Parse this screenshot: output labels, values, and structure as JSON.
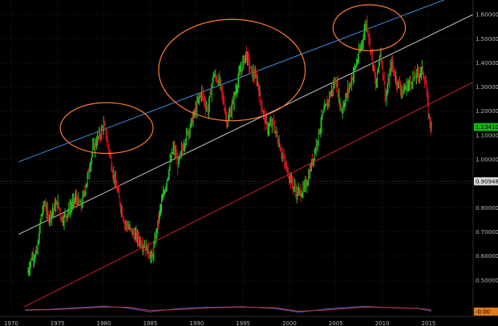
{
  "chart_data": {
    "type": "ohlc",
    "xlim": [
      1968.8,
      2019.8
    ],
    "ylim": [
      0.4,
      1.66
    ],
    "x_ticks": [
      "1970",
      "1975",
      "1980",
      "1985",
      "1990",
      "1995",
      "2000",
      "2005",
      "2010",
      "2015"
    ],
    "y_ticks": [
      "0.50000",
      "0.60000",
      "0.70000",
      "0.80000",
      "0.90000",
      "1.00000",
      "1.10000",
      "1.20000",
      "1.30000",
      "1.40000",
      "1.50000",
      "1.60000"
    ],
    "grid": "dotted",
    "colors": {
      "background": "#000000",
      "up": "#22c51e",
      "down": "#d2141e",
      "upper_channel": "#3f8fe0",
      "mid_channel": "#c8c8c8",
      "lower_channel": "#cc2020",
      "highlight_ellipse": "#ff7a3a",
      "last_price_flag": "#12b812",
      "crosshair_flag": "#d8d8d8"
    },
    "last_price": {
      "label": "1.13410",
      "value": 1.1341
    },
    "crosshair": {
      "label": "0.90948",
      "value": 0.90948
    },
    "trend_lines": [
      {
        "name": "upper-channel",
        "points": [
          [
            1970.8,
            0.99
          ],
          [
            2018.0,
            1.68
          ]
        ]
      },
      {
        "name": "mid-channel",
        "points": [
          [
            1970.8,
            0.69
          ],
          [
            2019.8,
            1.6
          ]
        ]
      },
      {
        "name": "lower-channel",
        "points": [
          [
            1971.4,
            0.39
          ],
          [
            2019.8,
            1.32
          ]
        ]
      }
    ],
    "highlight_ellipses": [
      {
        "name": "peak-1980",
        "center": [
          1980.3,
          1.13
        ],
        "radius": [
          5.0,
          0.105
        ]
      },
      {
        "name": "peak-1995",
        "center": [
          1993.8,
          1.37
        ],
        "radius": [
          7.9,
          0.21
        ]
      },
      {
        "name": "peak-2008",
        "center": [
          2008.6,
          1.545
        ],
        "radius": [
          3.9,
          0.095
        ]
      }
    ],
    "indicator_panel": {
      "label": "-0.00",
      "series_colors": [
        "#3f5fd0",
        "#c03030"
      ],
      "values": [
        [
          1971.5,
          0.05,
          -0.04
        ],
        [
          1974.0,
          0.15,
          0.05
        ],
        [
          1977.0,
          0.55,
          0.35
        ],
        [
          1980.0,
          0.95,
          0.75
        ],
        [
          1982.5,
          0.5,
          0.7
        ],
        [
          1985.0,
          -0.45,
          -0.1
        ],
        [
          1988.0,
          0.35,
          0.1
        ],
        [
          1991.0,
          0.65,
          0.5
        ],
        [
          1995.0,
          0.8,
          0.7
        ],
        [
          1998.5,
          0.35,
          0.55
        ],
        [
          2001.0,
          -0.55,
          -0.3
        ],
        [
          2004.0,
          0.25,
          0.0
        ],
        [
          2008.0,
          0.9,
          0.7
        ],
        [
          2011.0,
          0.55,
          0.6
        ],
        [
          2014.0,
          0.35,
          0.4
        ],
        [
          2015.3,
          -0.3,
          0.05
        ]
      ]
    },
    "series": [
      {
        "name": "",
        "path": [
          [
            1971.8,
            0.535
          ],
          [
            1972.2,
            0.595
          ],
          [
            1972.8,
            0.615
          ],
          [
            1973.2,
            0.76
          ],
          [
            1973.6,
            0.82
          ],
          [
            1974.0,
            0.76
          ],
          [
            1974.5,
            0.79
          ],
          [
            1975.0,
            0.82
          ],
          [
            1975.5,
            0.75
          ],
          [
            1976.2,
            0.79
          ],
          [
            1977.0,
            0.84
          ],
          [
            1977.5,
            0.8
          ],
          [
            1978.2,
            0.92
          ],
          [
            1978.8,
            1.04
          ],
          [
            1979.5,
            1.1
          ],
          [
            1980.0,
            1.14
          ],
          [
            1980.5,
            1.05
          ],
          [
            1981.0,
            0.94
          ],
          [
            1981.5,
            0.86
          ],
          [
            1982.2,
            0.74
          ],
          [
            1983.0,
            0.7
          ],
          [
            1984.0,
            0.66
          ],
          [
            1984.8,
            0.62
          ],
          [
            1985.2,
            0.59
          ],
          [
            1986.0,
            0.78
          ],
          [
            1986.8,
            0.92
          ],
          [
            1987.5,
            1.05
          ],
          [
            1988.0,
            0.98
          ],
          [
            1988.8,
            1.09
          ],
          [
            1989.5,
            1.16
          ],
          [
            1990.5,
            1.28
          ],
          [
            1991.2,
            1.2
          ],
          [
            1991.8,
            1.35
          ],
          [
            1992.5,
            1.32
          ],
          [
            1993.3,
            1.15
          ],
          [
            1994.0,
            1.25
          ],
          [
            1994.6,
            1.35
          ],
          [
            1995.3,
            1.44
          ],
          [
            1995.8,
            1.37
          ],
          [
            1996.5,
            1.33
          ],
          [
            1997.0,
            1.22
          ],
          [
            1997.6,
            1.13
          ],
          [
            1998.2,
            1.15
          ],
          [
            1999.0,
            1.05
          ],
          [
            1999.6,
            0.97
          ],
          [
            2000.3,
            0.9
          ],
          [
            2000.8,
            0.86
          ],
          [
            2001.5,
            0.87
          ],
          [
            2002.0,
            0.92
          ],
          [
            2002.7,
            1.03
          ],
          [
            2003.5,
            1.17
          ],
          [
            2004.3,
            1.26
          ],
          [
            2005.0,
            1.33
          ],
          [
            2005.6,
            1.2
          ],
          [
            2006.2,
            1.27
          ],
          [
            2007.0,
            1.37
          ],
          [
            2007.6,
            1.45
          ],
          [
            2008.3,
            1.57
          ],
          [
            2008.8,
            1.45
          ],
          [
            2009.3,
            1.3
          ],
          [
            2009.8,
            1.45
          ],
          [
            2010.4,
            1.25
          ],
          [
            2011.0,
            1.4
          ],
          [
            2011.5,
            1.33
          ],
          [
            2012.2,
            1.28
          ],
          [
            2012.8,
            1.31
          ],
          [
            2013.5,
            1.34
          ],
          [
            2014.3,
            1.37
          ],
          [
            2014.7,
            1.31
          ],
          [
            2015.0,
            1.18
          ],
          [
            2015.3,
            1.134
          ]
        ]
      }
    ]
  }
}
